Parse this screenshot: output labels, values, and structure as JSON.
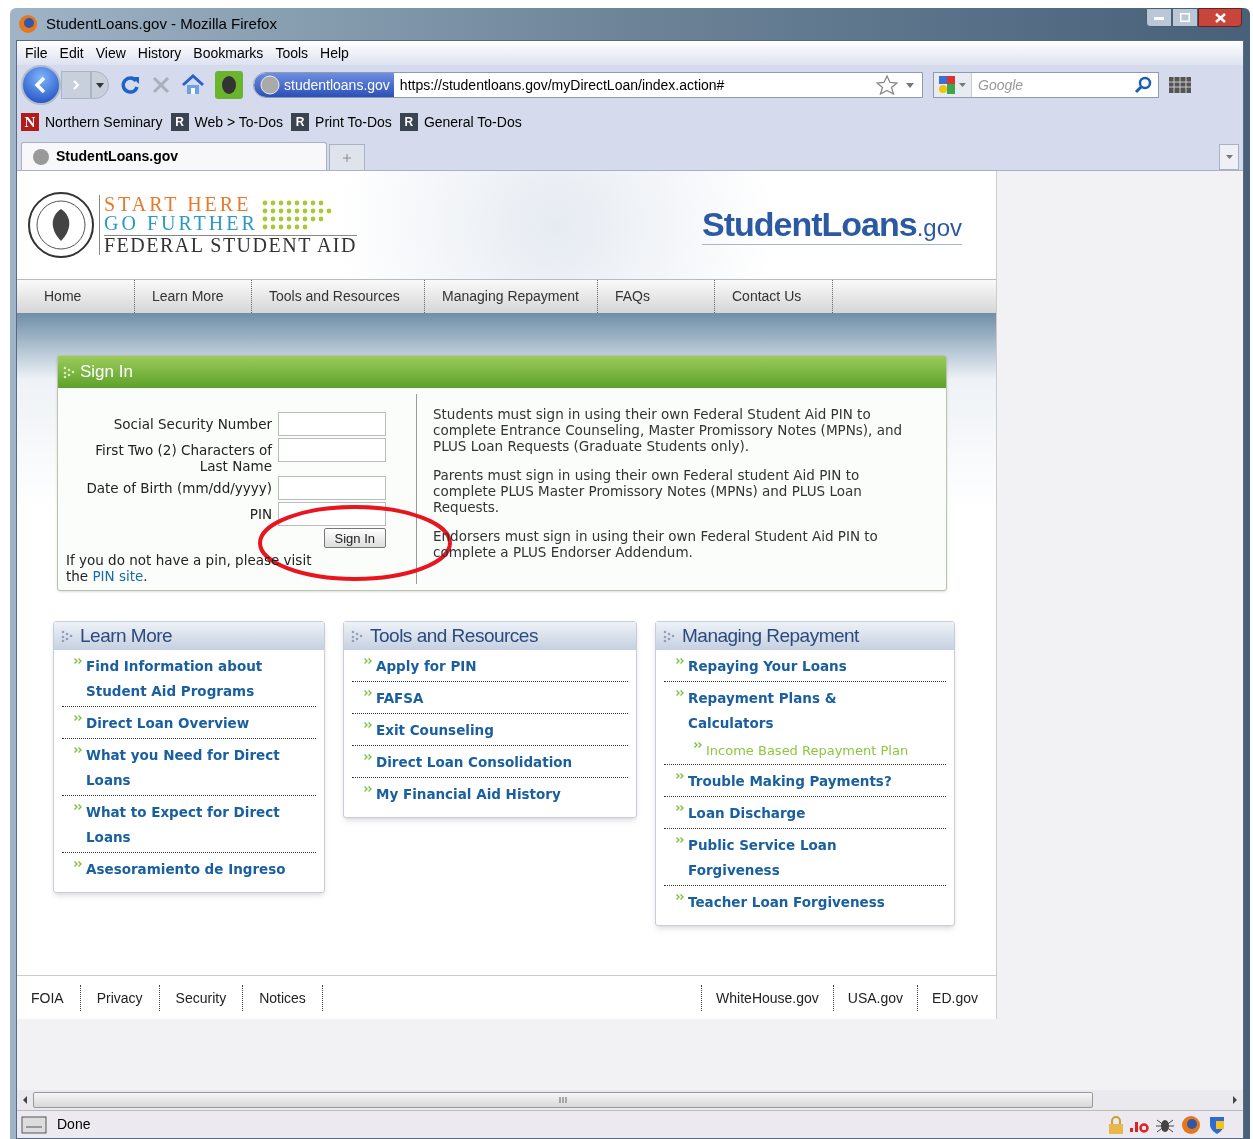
{
  "window": {
    "title": "StudentLoans.gov - Mozilla Firefox"
  },
  "menu": [
    "File",
    "Edit",
    "View",
    "History",
    "Bookmarks",
    "Tools",
    "Help"
  ],
  "address_bar": {
    "identity": "studentloans.gov",
    "url": "https://studentloans.gov/myDirectLoan/index.action#"
  },
  "search": {
    "placeholder": "Google"
  },
  "bookmarks": [
    {
      "badge": "N",
      "label": "Northern Seminary",
      "kind": "red"
    },
    {
      "badge": "R",
      "label": "Web > To-Dos",
      "kind": "dark"
    },
    {
      "badge": "R",
      "label": "Print To-Dos",
      "kind": "dark"
    },
    {
      "badge": "R",
      "label": "General To-Dos",
      "kind": "dark"
    }
  ],
  "tabs": [
    {
      "label": "StudentLoans.gov",
      "selected": true
    }
  ],
  "page": {
    "logo": {
      "line_1": "START HERE",
      "line_2": "GO FURTHER",
      "line_3": "FEDERAL STUDENT AID"
    },
    "site_name": {
      "main": "StudentLoans",
      "suffix": ".gov"
    },
    "nav": [
      "Home",
      "Learn More",
      "Tools and Resources",
      "Managing Repayment",
      "FAQs",
      "Contact Us"
    ],
    "sign_in": {
      "title": "Sign In",
      "fields": [
        {
          "label": "Social Security Number"
        },
        {
          "label": "First Two (2) Characters of Last Name"
        },
        {
          "label": "Date of Birth (mm/dd/yyyy)"
        },
        {
          "label": "PIN"
        }
      ],
      "button": "Sign In",
      "note": "If you do not have a pin, please visit the",
      "link": "PIN site",
      "note_end": ".",
      "info": [
        "Students must sign in using their own Federal Student Aid PIN to complete Entrance Counseling, Master Promissory Notes (MPNs), and PLUS Loan Requests (Graduate Students only).",
        "Parents must sign in using their own Federal student Aid PIN to complete PLUS Master Promissory Notes (MPNs) and PLUS Loan Requests.",
        "Endorsers must sign in using their own Federal Student Aid PIN to complete a PLUS Endorser Addendum."
      ]
    },
    "panels": [
      {
        "title": "Learn More",
        "links": [
          {
            "label": "Find Information about Student Aid Programs"
          },
          {
            "label": "Direct Loan Overview"
          },
          {
            "label": "What you Need for Direct Loans"
          },
          {
            "label": "What to Expect for Direct Loans"
          },
          {
            "label": "Asesoramiento de Ingreso"
          }
        ]
      },
      {
        "title": "Tools and Resources",
        "links": [
          {
            "label": "Apply for PIN"
          },
          {
            "label": "FAFSA"
          },
          {
            "label": "Exit Counseling"
          },
          {
            "label": "Direct Loan Consolidation"
          },
          {
            "label": "My Financial Aid History"
          }
        ]
      },
      {
        "title": "Managing Repayment",
        "links": [
          {
            "label": "Repaying Your Loans"
          },
          {
            "label": "Repayment Plans & Calculators",
            "children": [
              {
                "label": "Income Based Repayment Plan"
              }
            ]
          },
          {
            "label": "Trouble Making Payments?"
          },
          {
            "label": "Loan Discharge"
          },
          {
            "label": "Public Service Loan Forgiveness"
          },
          {
            "label": "Teacher Loan Forgiveness"
          }
        ]
      }
    ],
    "footer_left": [
      "FOIA",
      "Privacy",
      "Security",
      "Notices"
    ],
    "footer_right": [
      "WhiteHouse.gov",
      "USA.gov",
      "ED.gov"
    ]
  },
  "status_bar": {
    "text": "Done"
  }
}
